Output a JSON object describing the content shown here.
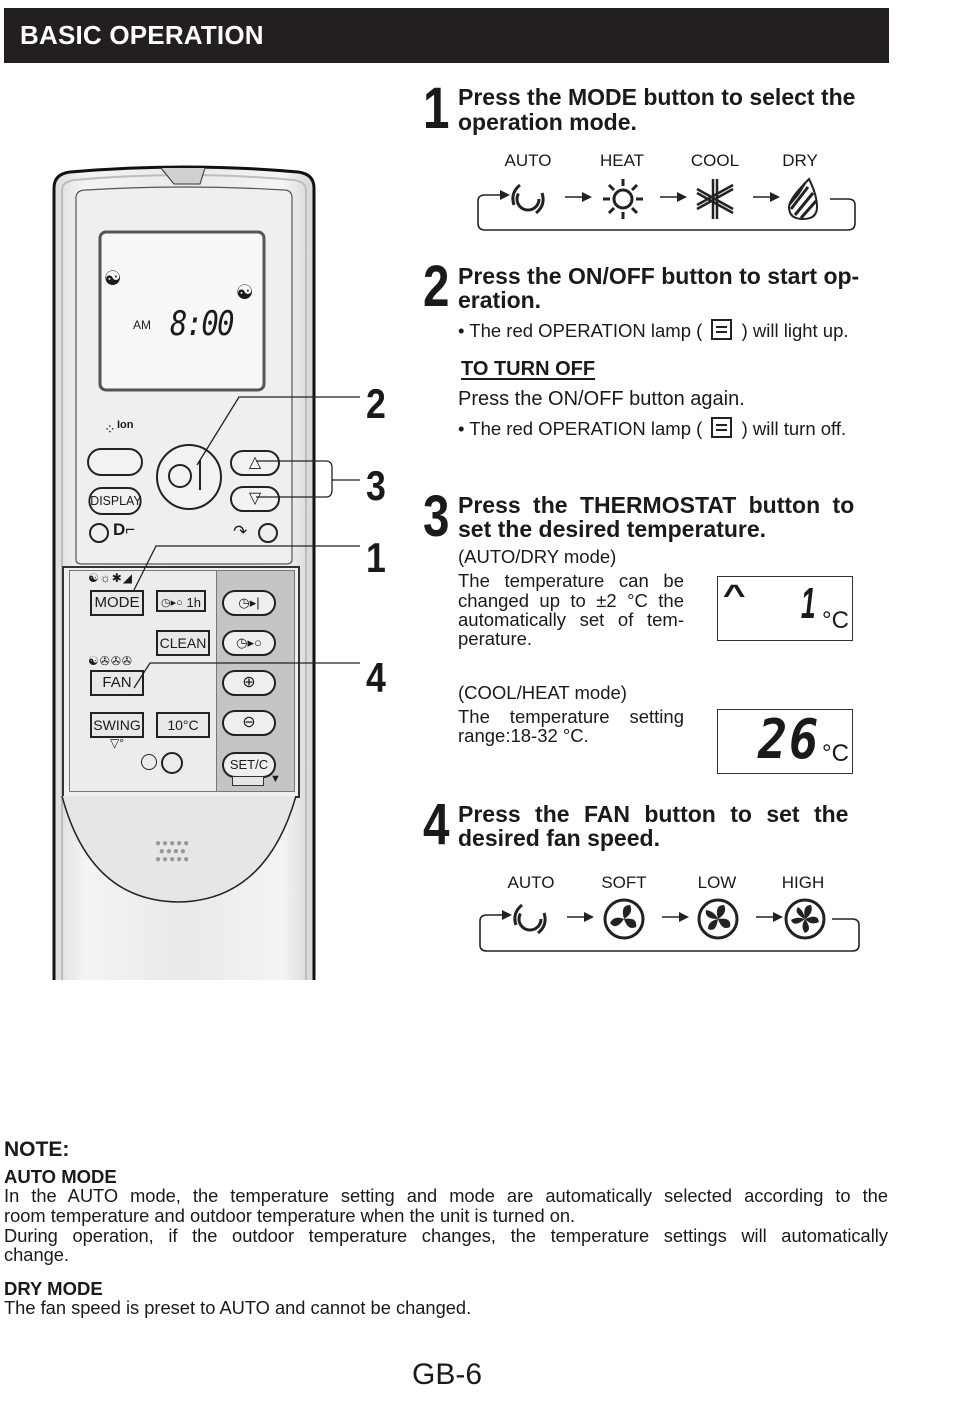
{
  "header": {
    "title": "BASIC OPERATION"
  },
  "steps": [
    {
      "number": "1",
      "title_line1": "Press the MODE button to select the",
      "title_line2": "operation mode.",
      "cycle": [
        {
          "label": "AUTO",
          "icon": "auto-swirl-icon"
        },
        {
          "label": "HEAT",
          "icon": "sun-icon"
        },
        {
          "label": "COOL",
          "icon": "snowflake-icon"
        },
        {
          "label": "DRY",
          "icon": "droplet-icon"
        }
      ]
    },
    {
      "number": "2",
      "title_line1": "Press the ON/OFF button to start op-",
      "title_line2": "eration.",
      "bullet1_pre": "• The red OPERATION lamp (",
      "bullet1_post": ") will light up.",
      "subheading": "TO TURN OFF",
      "turnoff_text": "Press the ON/OFF button again.",
      "bullet2_pre": "• The red OPERATION lamp (",
      "bullet2_post": ") will turn off."
    },
    {
      "number": "3",
      "title_line1": "Press the THERMOSTAT button to",
      "title_line2": "set the desired temperature.",
      "auto_dry": {
        "mode_label": "(AUTO/DRY mode)",
        "lines": [
          "The temperature can be",
          "changed up to ±2 °C the",
          "automatically set of tem-",
          "perature."
        ],
        "display_value": "1",
        "display_unit": "°C",
        "display_indicator": "^"
      },
      "cool_heat": {
        "mode_label": "(COOL/HEAT mode)",
        "lines": [
          "The temperature setting",
          "range:18-32 °C."
        ],
        "display_value": "26",
        "display_unit": "°C"
      }
    },
    {
      "number": "4",
      "title_line1": "Press the FAN button to set the",
      "title_line2": "desired fan speed.",
      "cycle": [
        {
          "label": "AUTO",
          "icon": "auto-swirl-icon"
        },
        {
          "label": "SOFT",
          "icon": "fan-icon"
        },
        {
          "label": "LOW",
          "icon": "fan-icon"
        },
        {
          "label": "HIGH",
          "icon": "fan-icon"
        }
      ]
    }
  ],
  "remote": {
    "lcd_am": "AM",
    "lcd_time": "8:00",
    "ion_label": "Ion",
    "buttons": {
      "display": "DISPLAY",
      "mode": "MODE",
      "timer_1h": "1h",
      "clean": "CLEAN",
      "fan": "FAN",
      "swing": "SWING",
      "ten_c": "10°C",
      "setc": "SET/C"
    },
    "callouts": [
      "2",
      "3",
      "1",
      "4"
    ]
  },
  "note": {
    "heading": "NOTE:",
    "auto_heading": "AUTO MODE",
    "auto_lines": [
      "In the AUTO mode, the temperature setting and mode are automatically selected according to the",
      "room temperature and outdoor temperature when the unit is turned on.",
      "During operation, if the outdoor temperature changes, the temperature settings will automatically",
      "change."
    ],
    "dry_heading": "DRY MODE",
    "dry_text": "The fan speed is preset to AUTO and cannot be changed."
  },
  "footer": {
    "page": "GB-6"
  }
}
